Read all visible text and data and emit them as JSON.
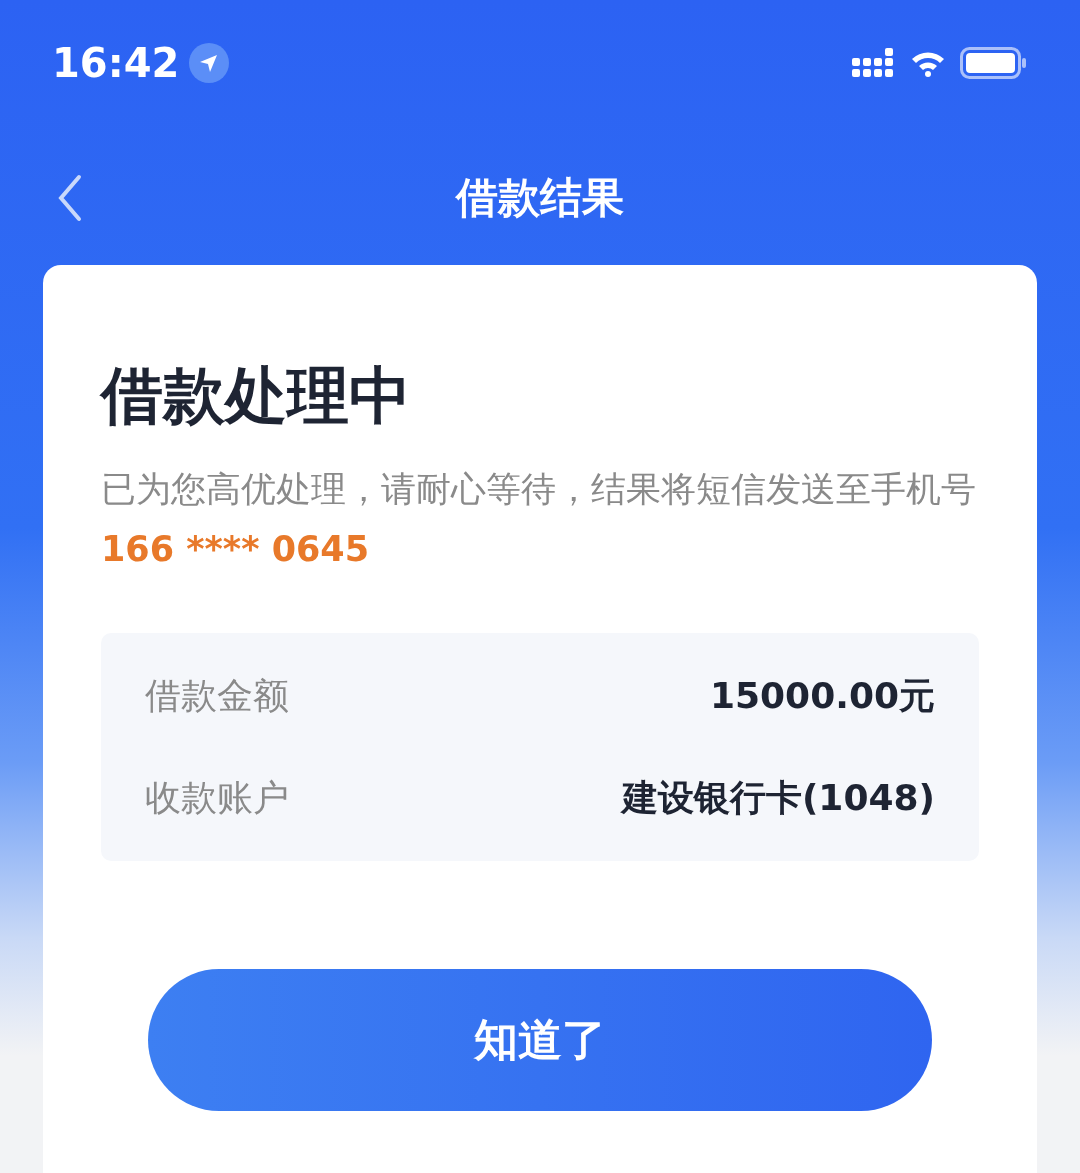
{
  "status_bar": {
    "time": "16:42"
  },
  "nav": {
    "title": "借款结果"
  },
  "card": {
    "title": "借款处理中",
    "message": "已为您高优处理，请耐心等待，结果将短信发送至手机号",
    "phone": "166 **** 0645",
    "details": [
      {
        "label": "借款金额",
        "value": "15000.00元"
      },
      {
        "label": "收款账户",
        "value": "建设银行卡(1048)"
      }
    ],
    "button": "知道了"
  }
}
